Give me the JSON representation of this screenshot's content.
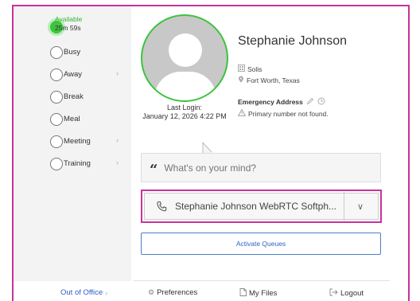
{
  "status_panel": {
    "current": {
      "label": "Available",
      "duration": "25m 59s"
    },
    "items": [
      {
        "label": "Busy",
        "has_submenu": false
      },
      {
        "label": "Away",
        "has_submenu": true
      },
      {
        "label": "Break",
        "has_submenu": false
      },
      {
        "label": "Meal",
        "has_submenu": false
      },
      {
        "label": "Meeting",
        "has_submenu": true
      },
      {
        "label": "Training",
        "has_submenu": true
      }
    ]
  },
  "profile": {
    "name": "Stephanie Johnson",
    "company": "Solis",
    "location": "Fort Worth, Texas",
    "last_login_label": "Last Login:",
    "last_login_value": "January 12, 2026 4:22 PM",
    "emergency_title": "Emergency Address",
    "emergency_message": "Primary number not found."
  },
  "status_message": {
    "placeholder": "What's on your mind?"
  },
  "device": {
    "label": "Stephanie Johnson WebRTC Softph..."
  },
  "activate_queues": {
    "label": "Activate Queues"
  },
  "footer": {
    "out_of_office": "Out of Office",
    "preferences": "Preferences",
    "my_files": "My Files",
    "logout": "Logout"
  },
  "colors": {
    "accent_border": "#c8329b",
    "available": "#3cc43c",
    "link": "#2d62c0"
  }
}
